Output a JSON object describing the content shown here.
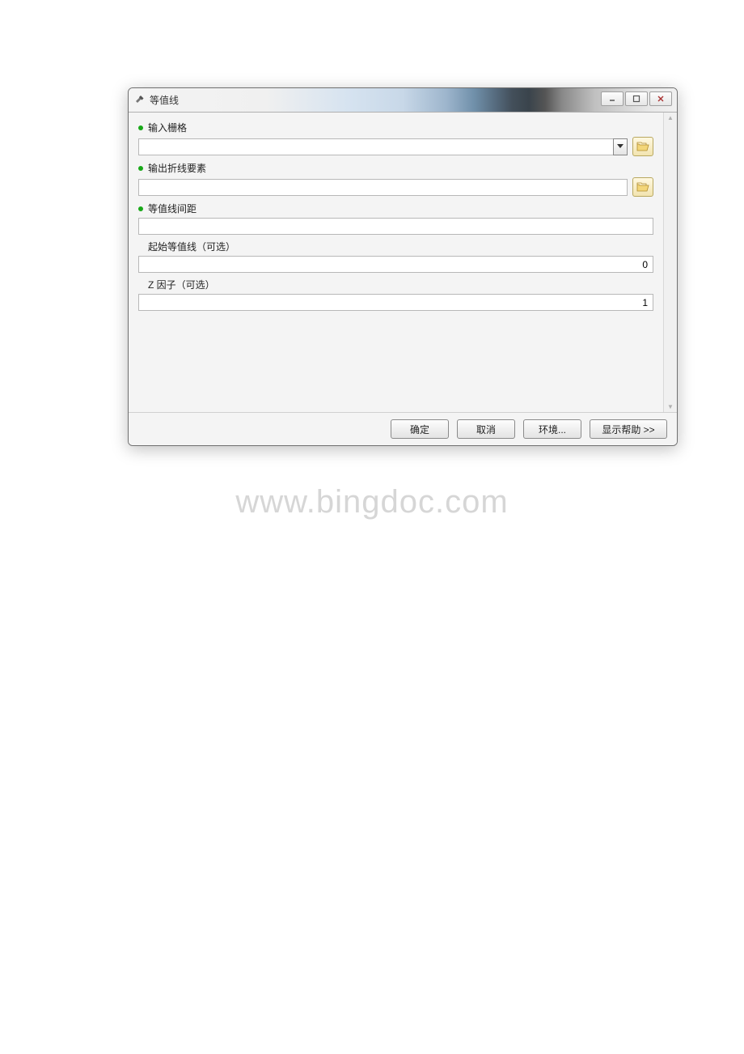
{
  "window": {
    "title": "等值线",
    "icon": "hammer-icon",
    "buttons": {
      "min": "minimize",
      "max": "maximize",
      "close": "close"
    }
  },
  "fields": {
    "input_raster": {
      "label": "输入栅格",
      "required": true,
      "value": ""
    },
    "output_polyline": {
      "label": "输出折线要素",
      "required": true,
      "value": ""
    },
    "contour_interval": {
      "label": "等值线间距",
      "required": true,
      "value": ""
    },
    "base_contour": {
      "label": "起始等值线（可选）",
      "required": false,
      "value": "0"
    },
    "z_factor": {
      "label": "Z 因子（可选）",
      "required": false,
      "value": "1"
    }
  },
  "footer": {
    "ok": "确定",
    "cancel": "取消",
    "environments": "环境...",
    "show_help": "显示帮助 >>"
  },
  "watermark": "www.bingdoc.com"
}
